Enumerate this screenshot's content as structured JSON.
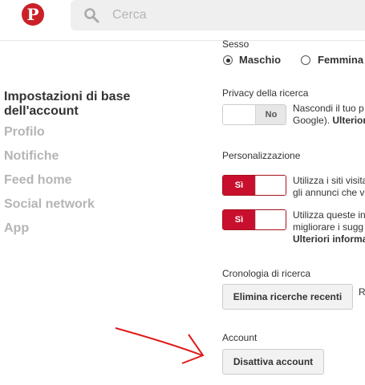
{
  "search": {
    "placeholder": "Cerca"
  },
  "sidebar": {
    "heading": "Impostazioni di base dell'account",
    "items": [
      {
        "label": "Profilo"
      },
      {
        "label": "Notifiche"
      },
      {
        "label": "Feed home"
      },
      {
        "label": "Social network"
      },
      {
        "label": "App"
      }
    ]
  },
  "gender": {
    "label": "Sesso",
    "options": [
      "Maschio",
      "Femmina"
    ],
    "selected": "Maschio"
  },
  "privacy": {
    "label": "Privacy della ricerca",
    "toggle": "No",
    "desc_line1": "Nascondi il tuo p",
    "desc_line2": "Google). ",
    "desc_link": "Ulterior"
  },
  "personalization": {
    "label": "Personalizzazione",
    "toggle1": "Sì",
    "desc1_line1": "Utilizza i siti visita",
    "desc1_line2": "gli annunci che v",
    "toggle2": "Sì",
    "desc2_line1": "Utilizza queste in",
    "desc2_line2": "migliorare i sugg",
    "desc2_link": "Ulteriori informa"
  },
  "history": {
    "label": "Cronologia di ricerca",
    "button": "Elimina ricerche recenti",
    "trail": "R"
  },
  "account": {
    "label": "Account",
    "button": "Disattiva account"
  },
  "colors": {
    "brand": "#cb2027",
    "toggle_on": "#c8102e",
    "arrow": "#e01b1b"
  }
}
